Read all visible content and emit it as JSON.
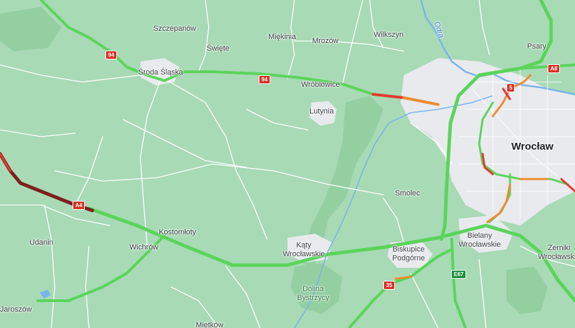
{
  "colors": {
    "land": "#a8dab5",
    "forest": "#94cfa2",
    "urban": "#e8eaed",
    "water": "#7ab4ea",
    "road_minor": "#ffffff",
    "road_major": "#5ad45a",
    "traffic_slow": "#ee8a2e",
    "traffic_jam": "#e23b2e",
    "traffic_stopped": "#7d1f1f"
  },
  "places": {
    "szczepanow": "Szczepanów",
    "swiete": "Święte",
    "miekinia": "Miękinia",
    "mrozow": "Mrozów",
    "wilkszyn": "Wilkszyn",
    "psary": "Psary",
    "sroda_slaska": "Środa Śląska",
    "wroblowice": "Wróblowice",
    "lutynia": "Lutynia",
    "wroclaw": "Wrocław",
    "smolec": "Smolec",
    "kostomloty": "Kostomłoty",
    "udanin": "Udanin",
    "wichrow": "Wichrów",
    "katy_wroclawskie": "Kąty\nWrocławskie",
    "biskupice_podgorne": "Biskupice\nPodgórne",
    "bielany_wroclawskie": "Bielany\nWrocławskie",
    "zerniki_wroclawskie": "Żerniki\nWrocławskie",
    "jaroszow": "Jaroszów",
    "dolina_bystrzycy": "Dolina\nBystrzycy",
    "mietkow": "Mietków"
  },
  "river": "Odra",
  "shields": {
    "s94_west": "94",
    "s94_mid": "94",
    "a8": "A8",
    "r5": "5",
    "a4": "A4",
    "s35": "35",
    "e67": "E67"
  }
}
